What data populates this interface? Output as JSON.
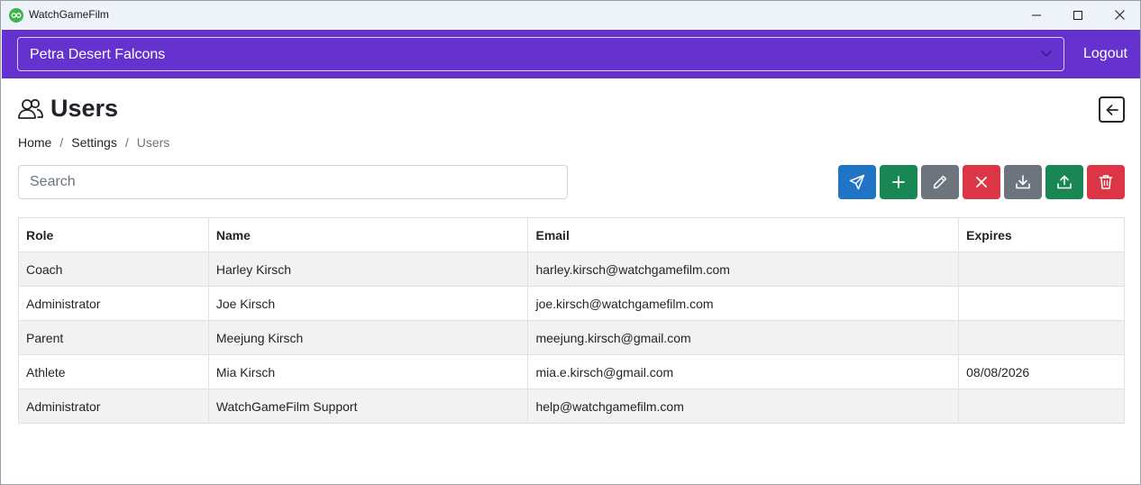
{
  "window": {
    "title": "WatchGameFilm"
  },
  "navbar": {
    "team_select_value": "Petra Desert Falcons",
    "logout_label": "Logout",
    "accent": "#6632cf"
  },
  "page": {
    "title": "Users",
    "breadcrumb": [
      "Home",
      "Settings",
      "Users"
    ]
  },
  "search": {
    "placeholder": "Search",
    "value": ""
  },
  "toolbar": {
    "buttons": [
      {
        "name": "send-button",
        "icon": "send-icon",
        "color": "#1f74c6"
      },
      {
        "name": "add-button",
        "icon": "plus-icon",
        "color": "#198754"
      },
      {
        "name": "edit-button",
        "icon": "pencil-icon",
        "color": "#6c757d"
      },
      {
        "name": "cancel-button",
        "icon": "x-icon",
        "color": "#dc3545"
      },
      {
        "name": "download-button",
        "icon": "download-icon",
        "color": "#6c757d"
      },
      {
        "name": "upload-button",
        "icon": "upload-icon",
        "color": "#198754"
      },
      {
        "name": "delete-button",
        "icon": "trash-icon",
        "color": "#dc3545"
      }
    ]
  },
  "table": {
    "headers": [
      "Role",
      "Name",
      "Email",
      "Expires"
    ],
    "rows": [
      [
        "Coach",
        "Harley Kirsch",
        "harley.kirsch@watchgamefilm.com",
        ""
      ],
      [
        "Administrator",
        "Joe Kirsch",
        "joe.kirsch@watchgamefilm.com",
        ""
      ],
      [
        "Parent",
        "Meejung Kirsch",
        "meejung.kirsch@gmail.com",
        ""
      ],
      [
        "Athlete",
        "Mia Kirsch",
        "mia.e.kirsch@gmail.com",
        "08/08/2026"
      ],
      [
        "Administrator",
        "WatchGameFilm Support",
        "help@watchgamefilm.com",
        ""
      ]
    ]
  }
}
